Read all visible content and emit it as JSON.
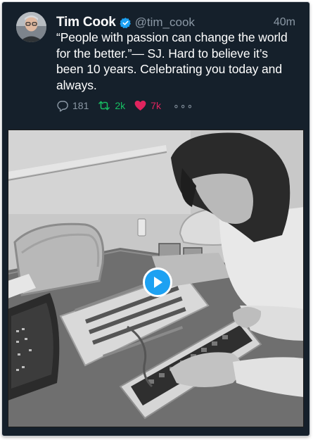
{
  "tweet": {
    "author_name": "Tim Cook",
    "handle": "@tim_cook",
    "time_ago": "40m",
    "text": "“People with passion can change the world for the better.”— SJ. Hard to believe it’s been 10 years. Celebrating you today and always.",
    "reply_count": "181",
    "retweet_count": "2k",
    "like_count": "7k",
    "more_label": "∘∘∘"
  },
  "colors": {
    "background": "#15202b",
    "verified": "#1da1f2",
    "retweet": "#17bf63",
    "like": "#e0245e",
    "muted": "#8b98a5"
  },
  "icons": {
    "reply": "speech-bubble",
    "retweet": "retweet-arrows",
    "like": "heart-filled",
    "verified": "verified-badge",
    "play": "play-triangle"
  }
}
